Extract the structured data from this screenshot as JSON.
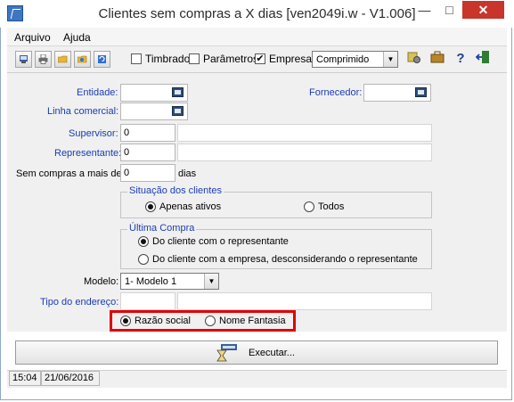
{
  "window": {
    "title": "Clientes sem compras a X dias [ven2049i.w - V1.006]"
  },
  "titlebar_buttons": {
    "minimize": "—",
    "maximize": "□",
    "close": "✕",
    "close_color": "#c7352b"
  },
  "menu": [
    "Arquivo",
    "Ajuda"
  ],
  "toolbar": {
    "buttons": [
      "print-preview-icon",
      "printer-icon",
      "folder-open-icon",
      "folder-config-icon",
      "refresh-icon"
    ],
    "timbrado": {
      "label": "Timbrado",
      "checked": false
    },
    "parametros": {
      "label": "Parâmetros",
      "checked": false
    },
    "empresa": {
      "label": "Empresa",
      "checked": true
    },
    "check_mark": "✔",
    "format_combo": "Comprimido",
    "right_icons": [
      "gear-icon",
      "briefcase-icon",
      "help-icon",
      "exit-door-icon"
    ],
    "help_glyph": "?"
  },
  "form": {
    "entidade_label": "Entidade:",
    "entidade_value": "",
    "fornecedor_label": "Fornecedor:",
    "fornecedor_value": "",
    "linha_label": "Linha comercial:",
    "linha_value": "",
    "supervisor_label": "Supervisor:",
    "supervisor_value": "0",
    "representante_label": "Representante:",
    "representante_value": "0",
    "sem_compras_label": "Sem compras a mais de:",
    "sem_compras_value": "0",
    "dias_label": "dias",
    "situacao_title": "Situação dos clientes",
    "situacao_options": [
      "Apenas ativos",
      "Todos"
    ],
    "situacao_selected": "Apenas ativos",
    "ultima_title": "Última Compra",
    "ultima_options": [
      "Do cliente com o representante",
      "Do cliente com a empresa, desconsiderando o representante"
    ],
    "ultima_selected": "Do cliente com o representante",
    "modelo_label": "Modelo:",
    "modelo_value": "1- Modelo 1",
    "tipo_endereco_label": "Tipo do endereço:",
    "tipo_endereco_value": "",
    "nome_options": [
      "Razão social",
      "Nome Fantasia"
    ],
    "nome_selected": "Razão social"
  },
  "execute_button": {
    "label": "Executar..."
  },
  "status": {
    "time": "15:04",
    "date": "21/06/2016"
  }
}
